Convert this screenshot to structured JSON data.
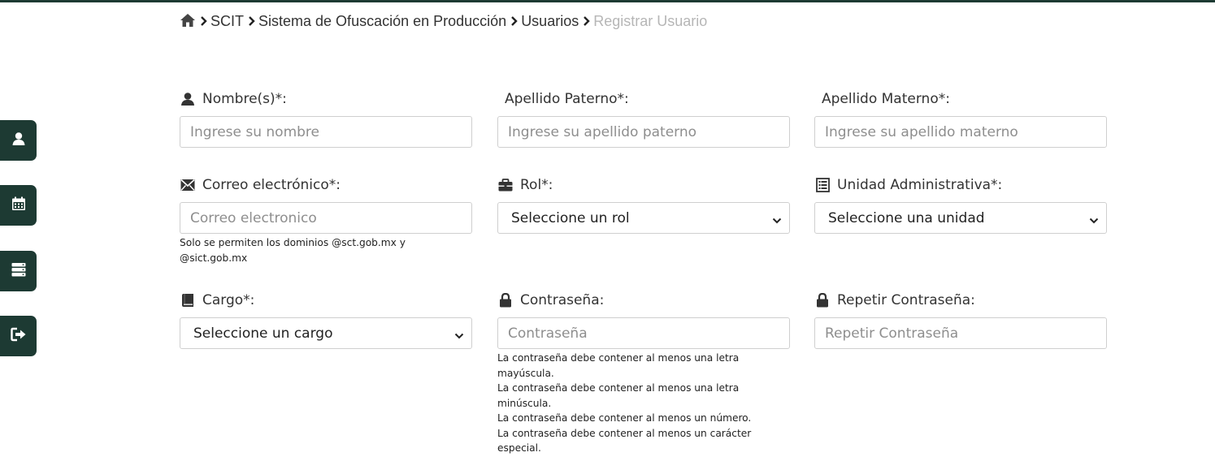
{
  "breadcrumb": {
    "items": [
      "SCIT",
      "Sistema de Ofuscación en Producción",
      "Usuarios"
    ],
    "current": "Registrar Usuario"
  },
  "sidebar": {
    "items": [
      {
        "icon": "user-icon"
      },
      {
        "icon": "calendar-icon"
      },
      {
        "icon": "server-icon"
      },
      {
        "icon": "logout-icon"
      }
    ]
  },
  "form": {
    "nombre": {
      "label": "Nombre(s)*:",
      "placeholder": "Ingrese su nombre",
      "icon": "user-icon"
    },
    "apellido_paterno": {
      "label": "Apellido Paterno*:",
      "placeholder": "Ingrese su apellido paterno"
    },
    "apellido_materno": {
      "label": "Apellido Materno*:",
      "placeholder": "Ingrese su apellido materno"
    },
    "correo": {
      "label": "Correo electrónico*:",
      "placeholder": "Correo electronico",
      "icon": "envelope-icon",
      "hint": "Solo se permiten los dominios @sct.gob.mx y @sict.gob.mx"
    },
    "rol": {
      "label": "Rol*:",
      "selected": "Seleccione un rol",
      "icon": "briefcase-icon"
    },
    "unidad": {
      "label": "Unidad Administrativa*:",
      "selected": "Seleccione una unidad",
      "icon": "list-icon"
    },
    "cargo": {
      "label": "Cargo*:",
      "selected": "Seleccione un cargo",
      "icon": "book-icon"
    },
    "contrasena": {
      "label": "Contraseña:",
      "placeholder": "Contraseña",
      "icon": "lock-icon",
      "rules": [
        "La contraseña debe contener al menos una letra mayúscula.",
        "La contraseña debe contener al menos una letra minúscula.",
        "La contraseña debe contener al menos un número.",
        "La contraseña debe contener al menos un carácter especial."
      ]
    },
    "repetir": {
      "label": "Repetir Contraseña:",
      "placeholder": "Repetir Contraseña",
      "icon": "lock-icon"
    }
  },
  "colors": {
    "sidebar": "#1d3a33",
    "text": "#333333",
    "muted": "#b6b6b6",
    "border": "#cfcfcf"
  }
}
